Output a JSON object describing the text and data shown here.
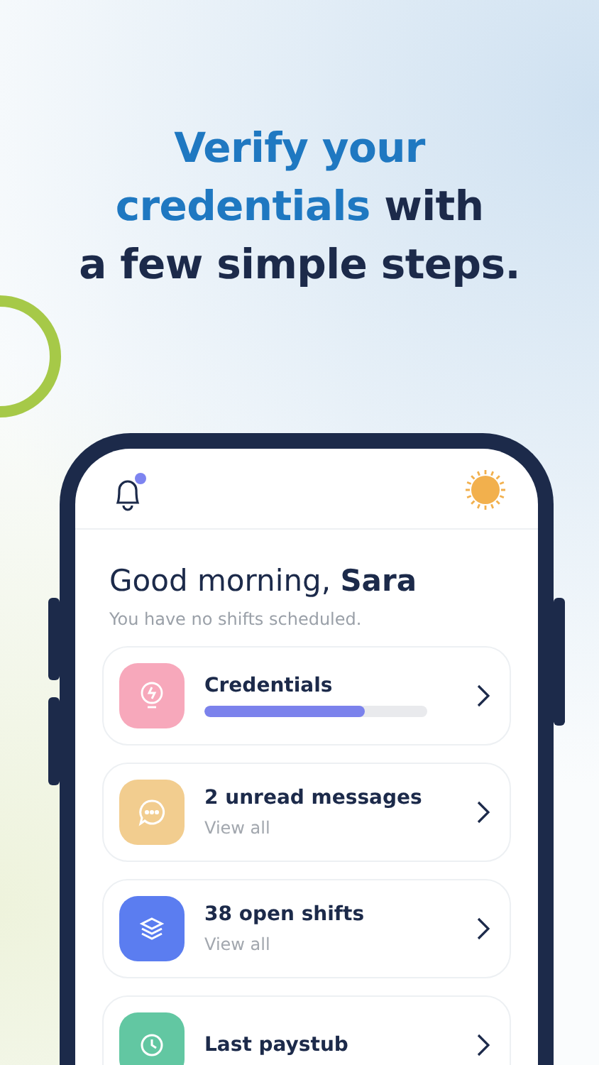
{
  "headline": [
    [
      {
        "text": "Verify your",
        "accent": true
      }
    ],
    [
      {
        "text": "credentials",
        "accent": true
      },
      {
        "text": " with",
        "accent": false
      }
    ],
    [
      {
        "text": "a few simple steps.",
        "accent": false
      }
    ]
  ],
  "header": {
    "notification_dot": true
  },
  "greeting": {
    "text": "Good morning, **Sara**",
    "subtitle": "You have no shifts scheduled."
  },
  "cards": [
    {
      "kind": "progress",
      "title": "Credentials",
      "level": 0.72,
      "color": "#f7a8bb"
    },
    {
      "kind": "link",
      "title": "2 unread messages",
      "subtitle": "View all",
      "color": "#f2cd8f"
    },
    {
      "kind": "link",
      "title": "38 open shifts",
      "subtitle": "View all",
      "color": "#5b7df0"
    },
    {
      "kind": "link",
      "title": "Last paystub",
      "color": "#62c7a2"
    }
  ]
}
